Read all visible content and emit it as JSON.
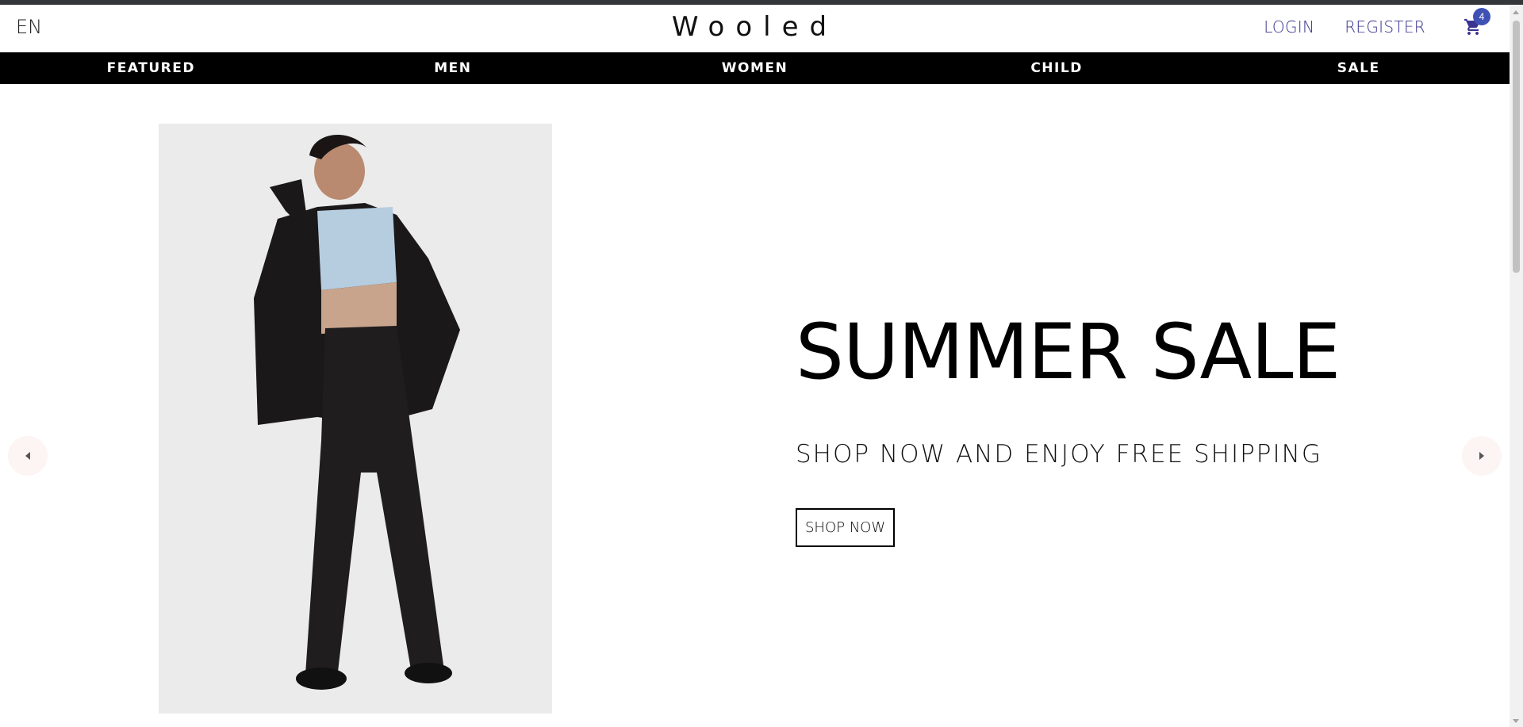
{
  "header": {
    "language": "EN",
    "logo": "Wooled",
    "login_label": "LOGIN",
    "register_label": "REGISTER",
    "cart_icon": "shopping-cart-icon",
    "cart_count": "4"
  },
  "categories": [
    {
      "label": "FEATURED"
    },
    {
      "label": "MEN"
    },
    {
      "label": "WOMEN"
    },
    {
      "label": "CHILD"
    },
    {
      "label": "SALE"
    }
  ],
  "slide": {
    "title": "SUMMER SALE",
    "subtitle": "SHOP NOW AND ENJOY FREE SHIPPING",
    "button_label": "SHOP NOW",
    "prev_icon": "arrow-left-icon",
    "next_icon": "arrow-right-icon"
  },
  "colors": {
    "nav_link": "#3a3390",
    "badge": "#3f51b5",
    "category_bar": "#000000",
    "arrow_bg": "#fcf5f3"
  }
}
